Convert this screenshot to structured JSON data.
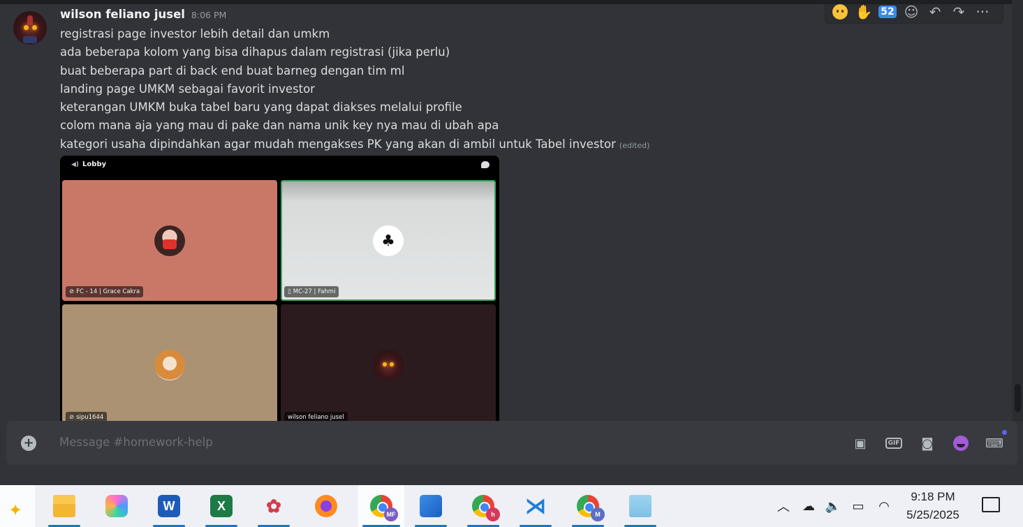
{
  "message": {
    "username": "wilson feliano jusel",
    "timestamp": "8:06 PM",
    "lines": [
      "registrasi page investor lebih detail dan umkm",
      "ada beberapa kolom yang bisa dihapus dalam registrasi (jika perlu)",
      "buat beberapa part di back end buat barneg dengan tim ml",
      "landing page UMKM sebagai favorit investor",
      "keterangan UMKM buka tabel baru yang dapat diakses melalui profile",
      "colom mana aja yang mau di pake dan nama unik key nya mau di ubah apa",
      "kategori usaha dipindahkan agar mudah mengakses PK yang akan di ambil untuk Tabel investor"
    ],
    "edited_label": "(edited)"
  },
  "toolbar": {
    "icons": [
      "emoji-face-icon",
      "ok-hand-icon",
      "number-52-icon",
      "add-reaction-icon",
      "reply-icon",
      "forward-icon",
      "more-icon"
    ],
    "number_badge": "52"
  },
  "embed": {
    "channel": "Lobby",
    "tiles": [
      {
        "label": "FC - 14 | Grace Cakra",
        "muted": true
      },
      {
        "label": "MC-27 | Fahmi",
        "muted": false
      },
      {
        "label": "sipu1644",
        "muted": true
      },
      {
        "label": "wilson feliano jusel",
        "muted": false
      }
    ]
  },
  "composer": {
    "placeholder": "Message #homework-help",
    "icons": [
      "gift-icon",
      "gif-icon",
      "sticker-icon",
      "emoji-icon",
      "activity-icon"
    ],
    "gif_label": "GIF"
  },
  "taskbar": {
    "apps": [
      "File Explorer",
      "Copilot",
      "Word",
      "Excel",
      "Figma",
      "Firefox",
      "Chrome MF",
      "Photos",
      "Chrome h",
      "VS Code",
      "Chrome M",
      "Notepad"
    ],
    "badges": {
      "chrome_mf": "MF",
      "chrome_h": "h",
      "chrome_m": "M"
    },
    "word_letter": "W",
    "excel_letter": "X",
    "time": "9:18 PM",
    "date": "5/25/2025"
  },
  "colors": {
    "chat_bg": "#313338",
    "composer_bg": "#383a40",
    "accent": "#5865f2",
    "taskbar_bg": "#eef0f6"
  }
}
